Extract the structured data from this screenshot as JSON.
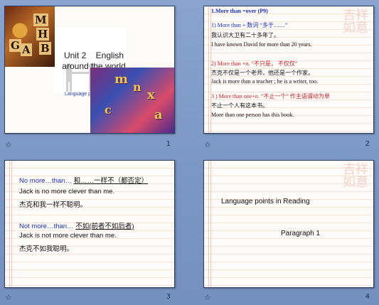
{
  "slides": [
    {
      "number": "1",
      "tile_letters": [
        "G",
        "A",
        "M",
        "H",
        "B"
      ],
      "title_line1": "Unit 2",
      "title_line2": "English",
      "title_line3": "around the world",
      "subtitle": "Language points",
      "image_letters": [
        "m",
        "n",
        "x",
        "c",
        "a"
      ]
    },
    {
      "number": "2",
      "heading": "1.More than =over  (P9)",
      "p1_head": "1) More than + 数词  “多于……”",
      "p1_cn": "我认识大卫有二十多年了。",
      "p1_en": "I have known David for more than 20 years.",
      "p2_head": "2) More than +n. “不只是， 不仅仅”",
      "p2_cn": "杰克不仅是一个老师，他还是一个作家。",
      "p2_en": "Jack  is more than a teacher ; he is a writer, too.",
      "p3_head": "3 ) More than one+n. “不止一个” 作主语谓动为单",
      "p3_cn": "不止一个人有这本书。",
      "p3_en": "More than one person has this book."
    },
    {
      "number": "3",
      "l1_en": "No more…than…",
      "l1_cn": "和……一样不（都否定）",
      "l2": "Jack is no more clever than me.",
      "l3": "杰克和我一样不聪明。",
      "l4_en": "Not more…than…",
      "l4_cn": "不如(前者不如后者)",
      "l5": "Jack is not more clever than me.",
      "l6": "杰克不如我聪明。"
    },
    {
      "number": "4",
      "title": "Language points  in  Reading",
      "sub": "Paragraph 1"
    }
  ],
  "footer_icon": "star-icon",
  "seal_text": "吉祥如意",
  "colors": {
    "accent_blue": "#1a2fb8",
    "accent_red": "#c8202a",
    "background": "#8aa4cf"
  }
}
